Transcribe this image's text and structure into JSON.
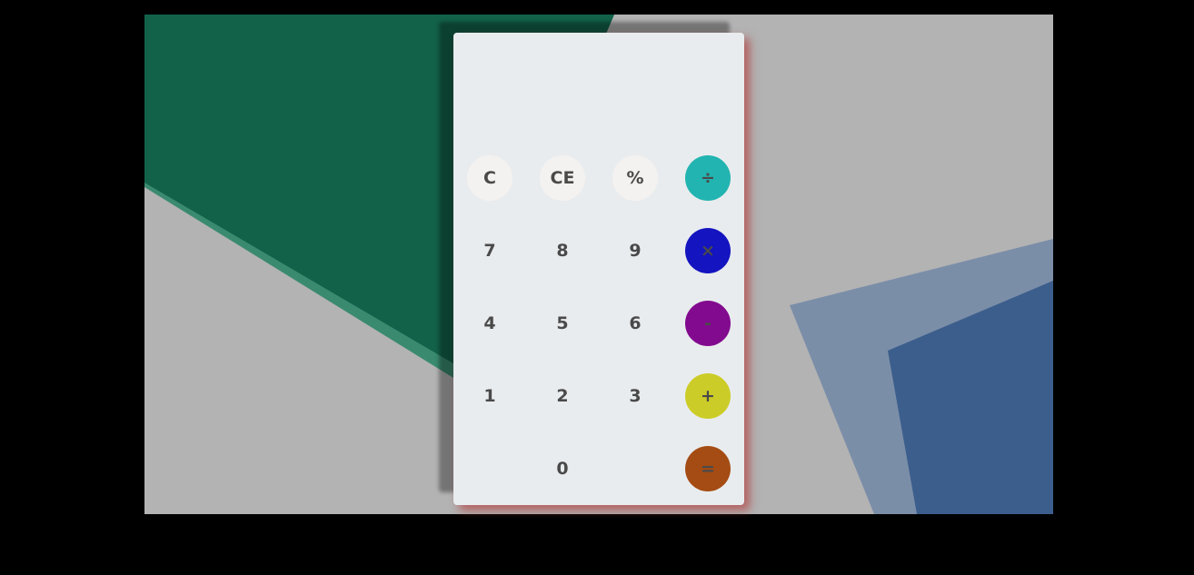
{
  "display": {
    "value": ""
  },
  "keys": {
    "clear": "C",
    "clear_entry": "CE",
    "percent": "%",
    "divide": "÷",
    "multiply": "×",
    "subtract": "-",
    "add": "+",
    "equals": "=",
    "seven": "7",
    "eight": "8",
    "nine": "9",
    "four": "4",
    "five": "5",
    "six": "6",
    "one": "1",
    "two": "2",
    "three": "3",
    "zero": "0"
  },
  "colors": {
    "divide": "#22b4b0",
    "multiply": "#1414c0",
    "subtract": "#820a8e",
    "add": "#cccc28",
    "equals": "#a44c14",
    "panel": "#e9ecee",
    "background": "#b3b3b3"
  }
}
